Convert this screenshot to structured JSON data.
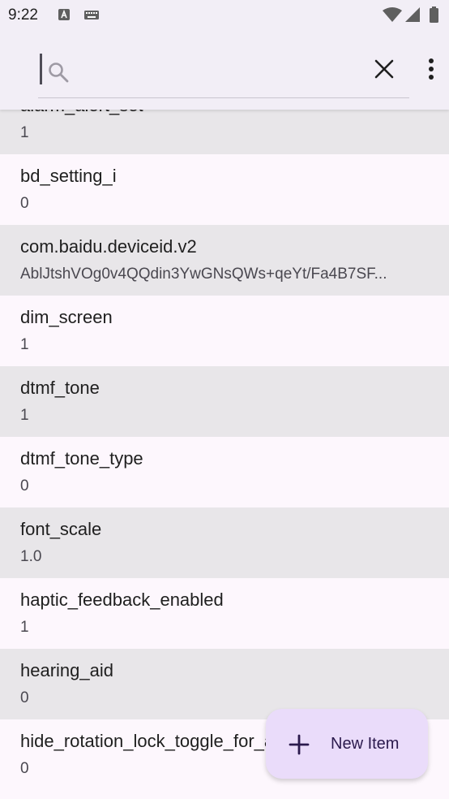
{
  "status_bar": {
    "time": "9:22",
    "icons": [
      "text-a-icon",
      "keyboard-icon",
      "wifi-icon",
      "cell-signal-icon",
      "battery-icon"
    ]
  },
  "search": {
    "placeholder": "",
    "value": "",
    "clear_icon": "close-icon",
    "more_icon": "more-vert-icon"
  },
  "list": {
    "items": [
      {
        "key": "alarm_alert_set",
        "value": "1"
      },
      {
        "key": "bd_setting_i",
        "value": "0"
      },
      {
        "key": "com.baidu.deviceid.v2",
        "value": "AblJtshVOg0v4QQdin3YwGNsQWs+qeYt/Fa4B7SF..."
      },
      {
        "key": "dim_screen",
        "value": "1"
      },
      {
        "key": "dtmf_tone",
        "value": "1"
      },
      {
        "key": "dtmf_tone_type",
        "value": "0"
      },
      {
        "key": "font_scale",
        "value": "1.0"
      },
      {
        "key": "haptic_feedback_enabled",
        "value": "1"
      },
      {
        "key": "hearing_aid",
        "value": "0"
      },
      {
        "key": "hide_rotation_lock_toggle_for_accessibility",
        "value": "0"
      }
    ]
  },
  "fab": {
    "label": "New Item",
    "icon": "plus-icon"
  },
  "colors": {
    "app_bar": "#f2eef6",
    "row_shaded": "#e8e6e9",
    "row_plain": "#fdf7fd",
    "fab": "#eadcfa"
  }
}
